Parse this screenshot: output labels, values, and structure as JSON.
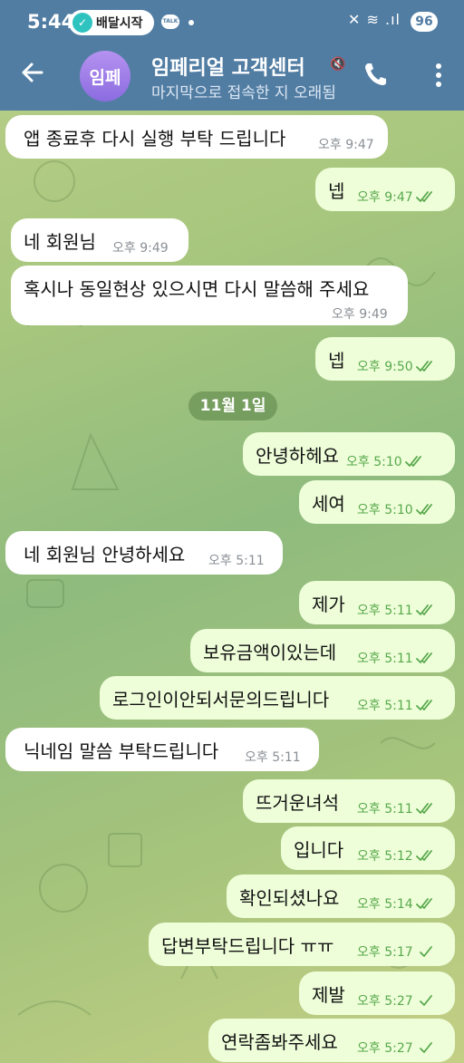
{
  "status_bar": {
    "time": "5:44",
    "app_pill_label": "배달시작",
    "talk_label": "TALK",
    "signal_glyphs": "✕ ≋ .ıl",
    "battery": "96"
  },
  "header": {
    "avatar_initials": "임페",
    "title": "임페리얼 고객센터",
    "subtitle": "마지막으로 접속한 지 오래됨",
    "icons": [
      "back-arrow-icon",
      "mute-icon",
      "phone-icon",
      "more-vert-icon"
    ]
  },
  "date_separator": "11월 1일",
  "colors": {
    "header_bg": "#527da3",
    "incoming_bubble": "#ffffff",
    "outgoing_bubble": "#eefed9",
    "outgoing_meta": "#58a84c",
    "avatar": "#9a7ae6"
  },
  "messages": [
    {
      "dir": "in",
      "text": "앱 종료후 다시 실행 부탁 드립니다",
      "time": "오후 9:47"
    },
    {
      "dir": "out",
      "text": "넵",
      "time": "오후 9:47",
      "status": "read"
    },
    {
      "dir": "in",
      "text": "네 회원님",
      "time": "오후 9:49"
    },
    {
      "dir": "in",
      "text": "혹시나 동일현상 있으시면 다시 말씀해 주세요",
      "time": "오후 9:49"
    },
    {
      "dir": "out",
      "text": "넵",
      "time": "오후 9:50",
      "status": "read"
    },
    {
      "dir": "out",
      "text": "안녕하헤요",
      "time": "오후 5:10",
      "status": "read"
    },
    {
      "dir": "out",
      "text": "세여",
      "time": "오후 5:10",
      "status": "read"
    },
    {
      "dir": "in",
      "text": "네 회원님 안녕하세요",
      "time": "오후 5:11"
    },
    {
      "dir": "out",
      "text": "제가",
      "time": "오후 5:11",
      "status": "read"
    },
    {
      "dir": "out",
      "text": "보유금액이있는데",
      "time": "오후 5:11",
      "status": "read"
    },
    {
      "dir": "out",
      "text": "로그인이안되서문의드립니다",
      "time": "오후 5:11",
      "status": "read"
    },
    {
      "dir": "in",
      "text": "닉네임 말씀 부탁드립니다",
      "time": "오후 5:11"
    },
    {
      "dir": "out",
      "text": "뜨거운녀석",
      "time": "오후 5:11",
      "status": "read"
    },
    {
      "dir": "out",
      "text": "입니다",
      "time": "오후 5:12",
      "status": "read"
    },
    {
      "dir": "out",
      "text": "확인되셨나요",
      "time": "오후 5:14",
      "status": "read"
    },
    {
      "dir": "out",
      "text": "답변부탁드립니다 ㅠㅠ",
      "time": "오후 5:17",
      "status": "sent"
    },
    {
      "dir": "out",
      "text": "제발",
      "time": "오후 5:27",
      "status": "sent"
    },
    {
      "dir": "out",
      "text": "연락좀봐주세요",
      "time": "오후 5:27",
      "status": "sent"
    }
  ]
}
